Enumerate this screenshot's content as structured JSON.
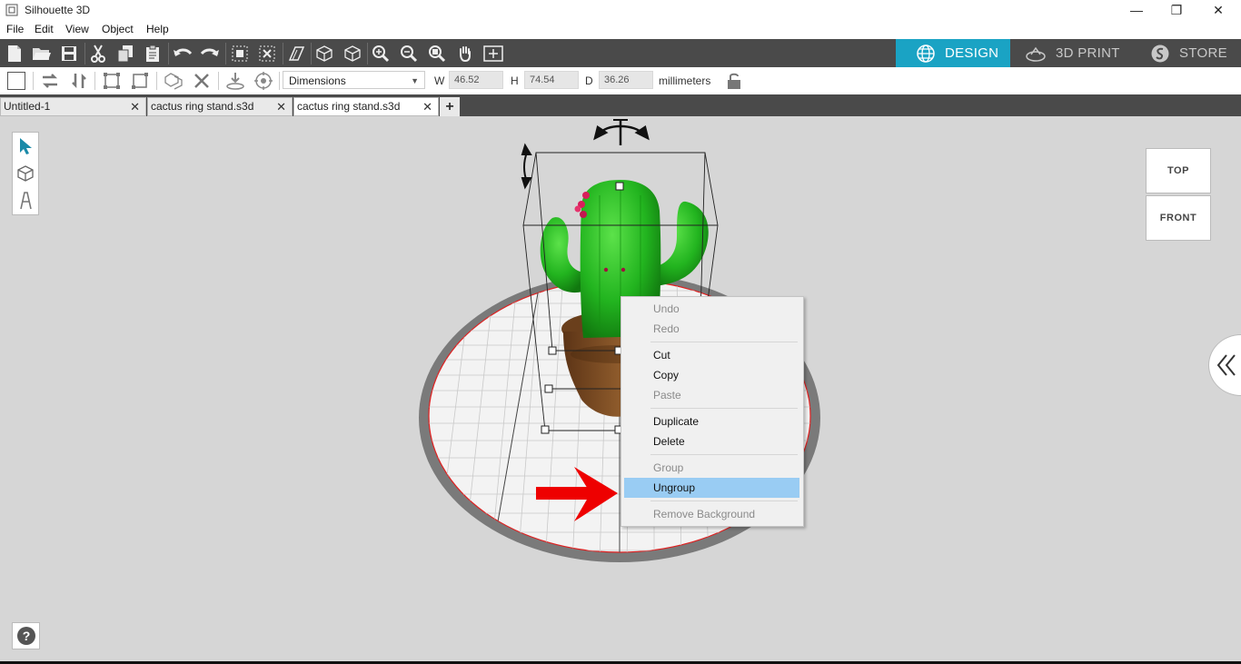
{
  "window": {
    "title": "Silhouette 3D",
    "minimize": "—",
    "restore": "❐",
    "close": "✕"
  },
  "menu": [
    "File",
    "Edit",
    "View",
    "Object",
    "Help"
  ],
  "modes": {
    "design": "DESIGN",
    "print": "3D PRINT",
    "store": "STORE",
    "active": "DESIGN",
    "accent": "#1aa3c4"
  },
  "properties": {
    "dropdown": "Dimensions",
    "w_label": "W",
    "w_value": "46.52",
    "h_label": "H",
    "h_value": "74.54",
    "d_label": "D",
    "d_value": "36.26",
    "unit": "millimeters"
  },
  "tabs": [
    {
      "label": "Untitled-1"
    },
    {
      "label": "cactus ring stand.s3d"
    },
    {
      "label": "cactus ring stand.s3d",
      "active": true
    }
  ],
  "view_cube": {
    "top": "TOP",
    "front": "FRONT"
  },
  "context_menu": {
    "undo": "Undo",
    "redo": "Redo",
    "cut": "Cut",
    "copy": "Copy",
    "paste": "Paste",
    "duplicate": "Duplicate",
    "delete": "Delete",
    "group": "Group",
    "ungroup": "Ungroup",
    "remove_background": "Remove Background",
    "highlighted": "Ungroup"
  },
  "colors": {
    "toolbar": "#4a4a4a",
    "cactus": "#22b41f",
    "pot": "#7a4a22",
    "arrow": "#ee0000",
    "menu_highlight": "#99ccf3"
  }
}
